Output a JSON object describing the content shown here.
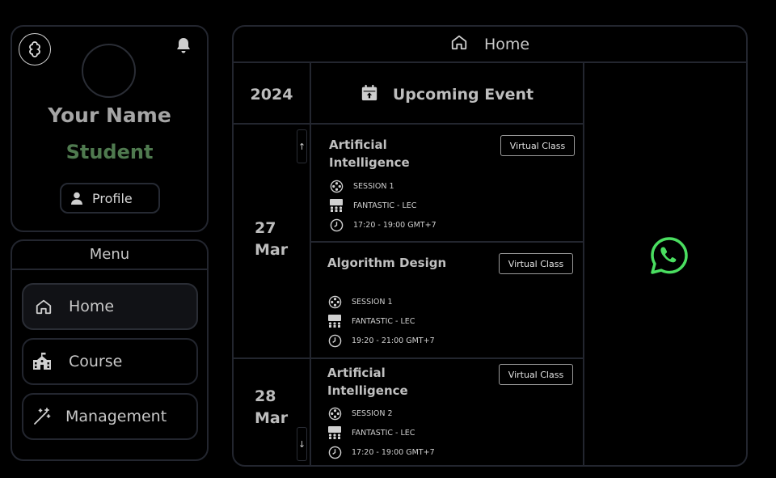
{
  "profile": {
    "name": "Your Name",
    "role": "Student",
    "profile_button": "Profile"
  },
  "menu": {
    "title": "Menu",
    "items": [
      {
        "label": "Home",
        "icon": "home-icon",
        "active": true
      },
      {
        "label": "Course",
        "icon": "school-icon",
        "active": false
      },
      {
        "label": "Management",
        "icon": "magic-wand-icon",
        "active": false
      }
    ]
  },
  "main": {
    "header_title": "Home",
    "year": "2024",
    "upcoming_title": "Upcoming Event",
    "dates": [
      {
        "day": "27",
        "month": "Mar"
      },
      {
        "day": "28",
        "month": "Mar"
      }
    ],
    "scroll_up": "↑",
    "scroll_down": "↓",
    "events": [
      {
        "title": "Artificial Intelligence",
        "button": "Virtual Class",
        "session": "SESSION 1",
        "class": "FANTASTIC - LEC",
        "time": "17:20 - 19:00 GMT+7"
      },
      {
        "title": "Algorithm Design",
        "button": "Virtual Class",
        "session": "SESSION 1",
        "class": "FANTASTIC - LEC",
        "time": "19:20 - 21:00 GMT+7"
      },
      {
        "title": "Artificial Intelligence",
        "button": "Virtual Class",
        "session": "SESSION 2",
        "class": "FANTASTIC - LEC",
        "time": "17:20 - 19:00 GMT+7"
      }
    ]
  },
  "colors": {
    "background": "#000000",
    "border": "#23262f",
    "role_green": "#4f7a4f",
    "whatsapp_green": "#4ade60"
  }
}
